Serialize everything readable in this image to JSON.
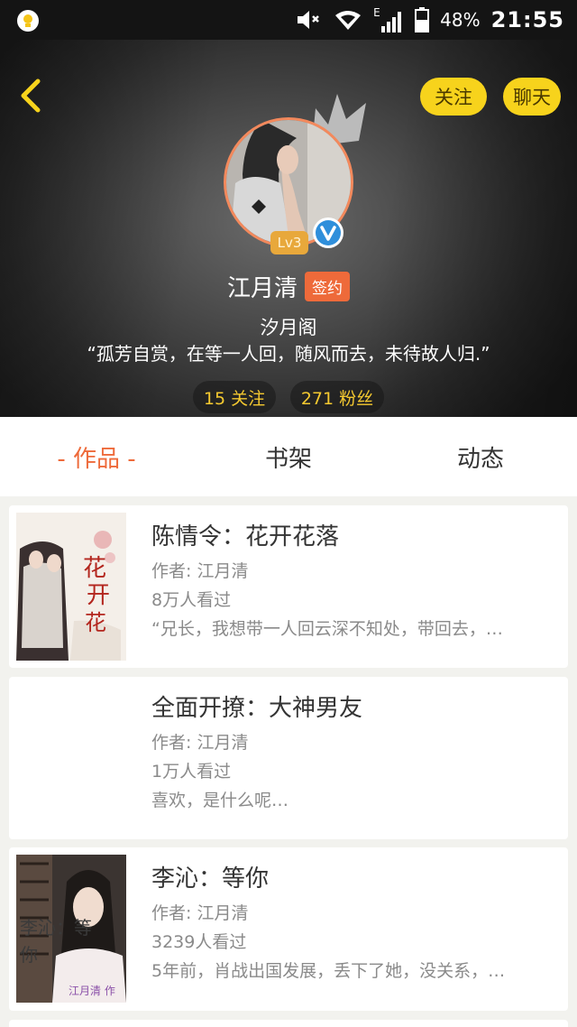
{
  "status_bar": {
    "app_icon": "lightbulb-app-icon",
    "network_label": "E",
    "battery_percent": "48%",
    "time": "21:55"
  },
  "header": {
    "back_icon": "chevron-left-icon",
    "follow_label": "关注",
    "chat_label": "聊天"
  },
  "profile": {
    "level": "Lv3",
    "name": "江月清",
    "sign_badge": "签约",
    "group": "汐月阁",
    "motto": "“孤芳自赏，在等一人回，随风而去，未待故人归.”",
    "following": "15 关注",
    "fans": "271 粉丝",
    "accent_color": "#ee6a3a",
    "badge_color": "#f7d31c"
  },
  "tabs": [
    {
      "label": "- 作品 -",
      "active": true
    },
    {
      "label": "书架",
      "active": false
    },
    {
      "label": "动态",
      "active": false
    }
  ],
  "books": [
    {
      "title": "陈情令：花开花落",
      "author": "作者: 江月清",
      "reads": "8万人看过",
      "description": "“兄长，我想带一人回云深不知处，带回去，…"
    },
    {
      "title": "全面开撩：大神男友",
      "author": "作者: 江月清",
      "reads": "1万人看过",
      "description": "喜欢，是什么呢…"
    },
    {
      "title": "李沁：等你",
      "author": "作者: 江月清",
      "reads": "3239人看过",
      "description": "5年前，肖战出国发展，丢下了她，没关系，…",
      "cover_text": "李沁：等你",
      "cover_byline": "江月清 作"
    }
  ]
}
